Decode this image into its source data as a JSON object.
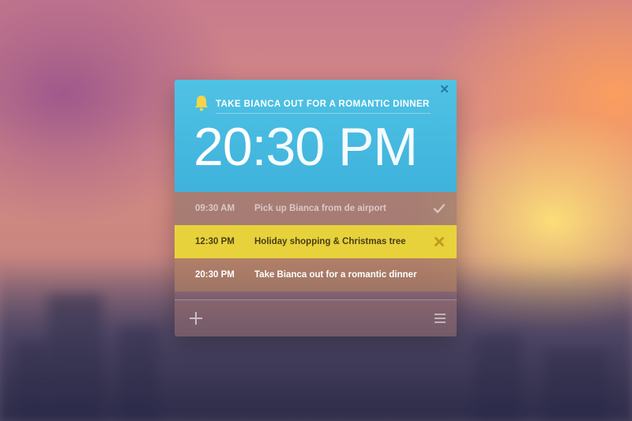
{
  "alarm": {
    "title": "TAKE BIANCA OUT FOR A ROMANTIC DINNER",
    "time_hour": "20",
    "time_rest": ":30 PM"
  },
  "reminders": [
    {
      "time": "09:30 AM",
      "label": "Pick up Bianca from de airport",
      "status": "done",
      "icon": "check-icon"
    },
    {
      "time": "12:30 PM",
      "label": "Holiday shopping & Christmas tree",
      "status": "active",
      "icon": "remove-icon"
    },
    {
      "time": "20:30 PM",
      "label": "Take Bianca out for a romantic dinner",
      "status": "pending",
      "icon": ""
    }
  ],
  "colors": {
    "header": "#4fc2e4",
    "highlight": "#e8d23c",
    "bell": "#f3d44a",
    "remove": "#c09a20"
  },
  "icons": {
    "close": "close-icon",
    "bell": "bell-icon",
    "add": "plus-icon",
    "menu": "menu-icon"
  }
}
